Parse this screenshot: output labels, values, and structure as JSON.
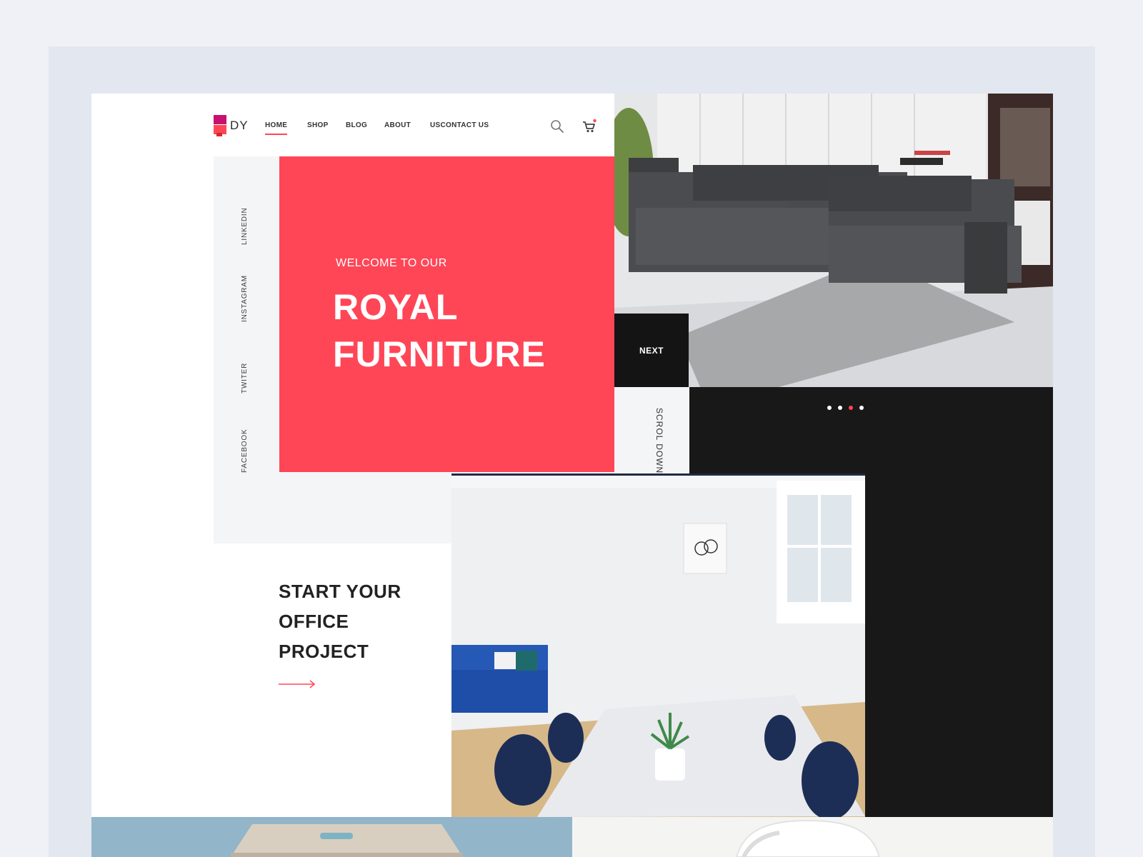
{
  "brand": {
    "logo_text": "DY",
    "accent": "#ff4657",
    "dark": "#181818"
  },
  "nav": {
    "items": [
      "HOME",
      "SHOP",
      "BLOG",
      "ABOUT",
      "USCONTACT US"
    ],
    "active": "HOME",
    "icons": [
      "search-icon",
      "cart-icon"
    ]
  },
  "social": [
    "LINKEDIN",
    "INSTAGRAM",
    "TWITER",
    "FACEBOOK"
  ],
  "hero": {
    "welcome": "WELCOME TO OUR",
    "title_line1": "ROYAL",
    "title_line2": "FURNITURE"
  },
  "slider": {
    "next_label": "NEXT",
    "scroll_label": "SCROL DOWN",
    "dot_count": 4,
    "active_dot": 3
  },
  "office": {
    "line1": "START YOUR",
    "line2": "OFFICE",
    "line3": "PROJECT"
  }
}
